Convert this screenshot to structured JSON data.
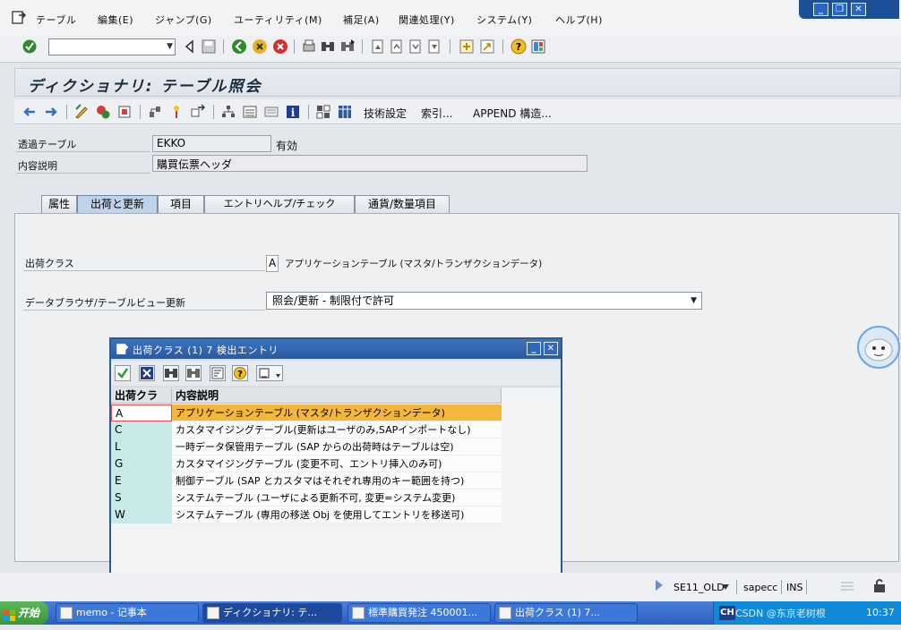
{
  "menu": {
    "items": [
      "テーブル",
      "編集(E)",
      "ジャンプ(G)",
      "ユーティリティ(M)",
      "補足(A)",
      "関連処理(Y)",
      "システム(Y)",
      "ヘルプ(H)"
    ]
  },
  "title": "ディクショナリ: テーブル照会",
  "apptoolbar": {
    "tech_settings": "技術設定",
    "indexes": "索引...",
    "append": "APPEND 構造..."
  },
  "fields": {
    "table_label": "透過テーブル",
    "table_value": "EKKO",
    "table_status": "有効",
    "desc_label": "内容説明",
    "desc_value": "購買伝票ヘッダ"
  },
  "tabs": [
    "属性",
    "出荷と更新",
    "項目",
    "エントリヘルプ/チェック",
    "通貨/数量項目"
  ],
  "delivery": {
    "class_label": "出荷クラス",
    "class_value": "A",
    "class_desc": "アプリケーションテーブル (マスタ/トランザクションデータ)",
    "browser_label": "データブラウザ/テーブルビュー更新",
    "browser_value": "照会/更新 - 制限付で許可"
  },
  "popup": {
    "title": "出荷クラス (1)  7 検出エントリ",
    "col_key": "出荷クラ",
    "col_desc": "内容説明",
    "rows": [
      {
        "key": "A",
        "desc": "アプリケーションテーブル (マスタ/トランザクションデータ)"
      },
      {
        "key": "C",
        "desc": "カスタマイジングテーブル(更新はユーザのみ,SAPインポートなし)"
      },
      {
        "key": "L",
        "desc": "一時データ保管用テーブル (SAP からの出荷時はテーブルは空)"
      },
      {
        "key": "G",
        "desc": "カスタマイジングテーブル (変更不可、エントリ挿入のみ可)"
      },
      {
        "key": "E",
        "desc": "制御テーブル (SAP とカスタマはそれぞれ専用のキー範囲を持つ)"
      },
      {
        "key": "S",
        "desc": "システムテーブル (ユーザによる更新不可, 変更=システム変更)"
      },
      {
        "key": "W",
        "desc": "システムテーブル (専用の移送 Obj を使用してエントリを移送可)"
      }
    ]
  },
  "status": {
    "system": "SE11_OLD",
    "client": "sapecc",
    "mode": "INS"
  },
  "taskbar": {
    "start": "开始",
    "tasks": [
      "memo - 记事本",
      "ディクショナリ: テ...",
      "標準購買発注 450001...",
      "出荷クラス (1)   7..."
    ],
    "lang": "CH",
    "clock": "10:37",
    "watermark": "CSDN @东京老树根"
  }
}
